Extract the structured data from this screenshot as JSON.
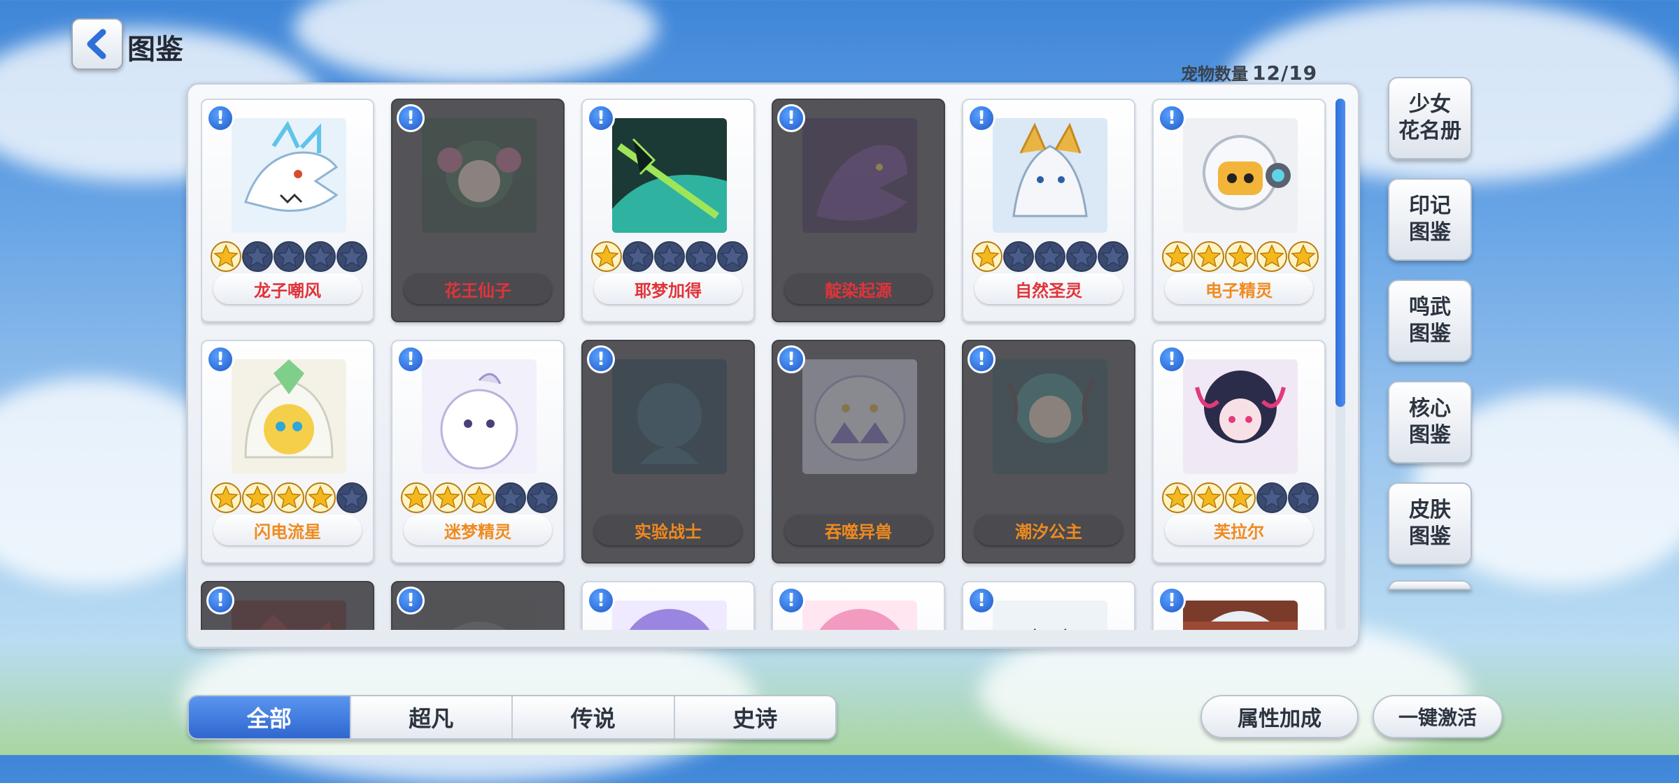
{
  "header": {
    "title": "图鉴",
    "count_label": "宠物数量",
    "count_value": "12/19"
  },
  "pets": [
    {
      "name": "龙子嘲风",
      "stars": 1,
      "locked": false,
      "name_color": "#e0343a",
      "art": "dragon"
    },
    {
      "name": "花王仙子",
      "stars": 0,
      "locked": true,
      "name_color": "#e0343a",
      "art": "fairy"
    },
    {
      "name": "耶梦加得",
      "stars": 1,
      "locked": false,
      "name_color": "#e0343a",
      "art": "serpent"
    },
    {
      "name": "靛染起源",
      "stars": 0,
      "locked": true,
      "name_color": "#e0343a",
      "art": "darkdragon"
    },
    {
      "name": "自然圣灵",
      "stars": 1,
      "locked": false,
      "name_color": "#e0343a",
      "art": "wolf"
    },
    {
      "name": "电子精灵",
      "stars": 5,
      "locked": false,
      "name_color": "#f08a1e",
      "art": "robot"
    },
    {
      "name": "闪电流星",
      "stars": 4,
      "locked": false,
      "name_color": "#f08a1e",
      "art": "lightning"
    },
    {
      "name": "迷梦精灵",
      "stars": 3,
      "locked": false,
      "name_color": "#f08a1e",
      "art": "dream"
    },
    {
      "name": "实验战士",
      "stars": 0,
      "locked": true,
      "name_color": "#f08a1e",
      "art": "warrior"
    },
    {
      "name": "吞噬异兽",
      "stars": 0,
      "locked": true,
      "name_color": "#f08a1e",
      "art": "beast"
    },
    {
      "name": "潮汐公主",
      "stars": 0,
      "locked": true,
      "name_color": "#f08a1e",
      "art": "princess"
    },
    {
      "name": "芙拉尔",
      "stars": 3,
      "locked": false,
      "name_color": "#f08a1e",
      "art": "flora"
    },
    {
      "name": "",
      "stars": 0,
      "locked": true,
      "name_color": "#f08a1e",
      "art": "red"
    },
    {
      "name": "",
      "stars": 0,
      "locked": true,
      "name_color": "#f08a1e",
      "art": "gray"
    },
    {
      "name": "",
      "stars": 0,
      "locked": false,
      "name_color": "#f08a1e",
      "art": "purple"
    },
    {
      "name": "",
      "stars": 0,
      "locked": false,
      "name_color": "#f08a1e",
      "art": "pink"
    },
    {
      "name": "",
      "stars": 0,
      "locked": false,
      "name_color": "#f08a1e",
      "art": "white"
    },
    {
      "name": "",
      "stars": 0,
      "locked": false,
      "name_color": "#f08a1e",
      "art": "brown"
    }
  ],
  "side_buttons": [
    {
      "label": "少女\n花名册"
    },
    {
      "label": "印记\n图鉴"
    },
    {
      "label": "鸣武\n图鉴"
    },
    {
      "label": "核心\n图鉴"
    },
    {
      "label": "皮肤\n图鉴"
    }
  ],
  "tabs": [
    {
      "label": "全部",
      "active": true
    },
    {
      "label": "超凡",
      "active": false
    },
    {
      "label": "传说",
      "active": false
    },
    {
      "label": "史诗",
      "active": false
    }
  ],
  "buttons": {
    "attribute_bonus": "属性加成",
    "activate_all": "一键激活"
  },
  "icons": {
    "back": "chevron-left-icon",
    "info": "exclamation-icon",
    "star": "star-icon"
  },
  "colors": {
    "accent": "#2f67cf",
    "star_filled": "#f5b81c",
    "star_empty": "#4a5d8a"
  },
  "scroll": {
    "position": 0.0,
    "visible_fraction": 0.58
  }
}
